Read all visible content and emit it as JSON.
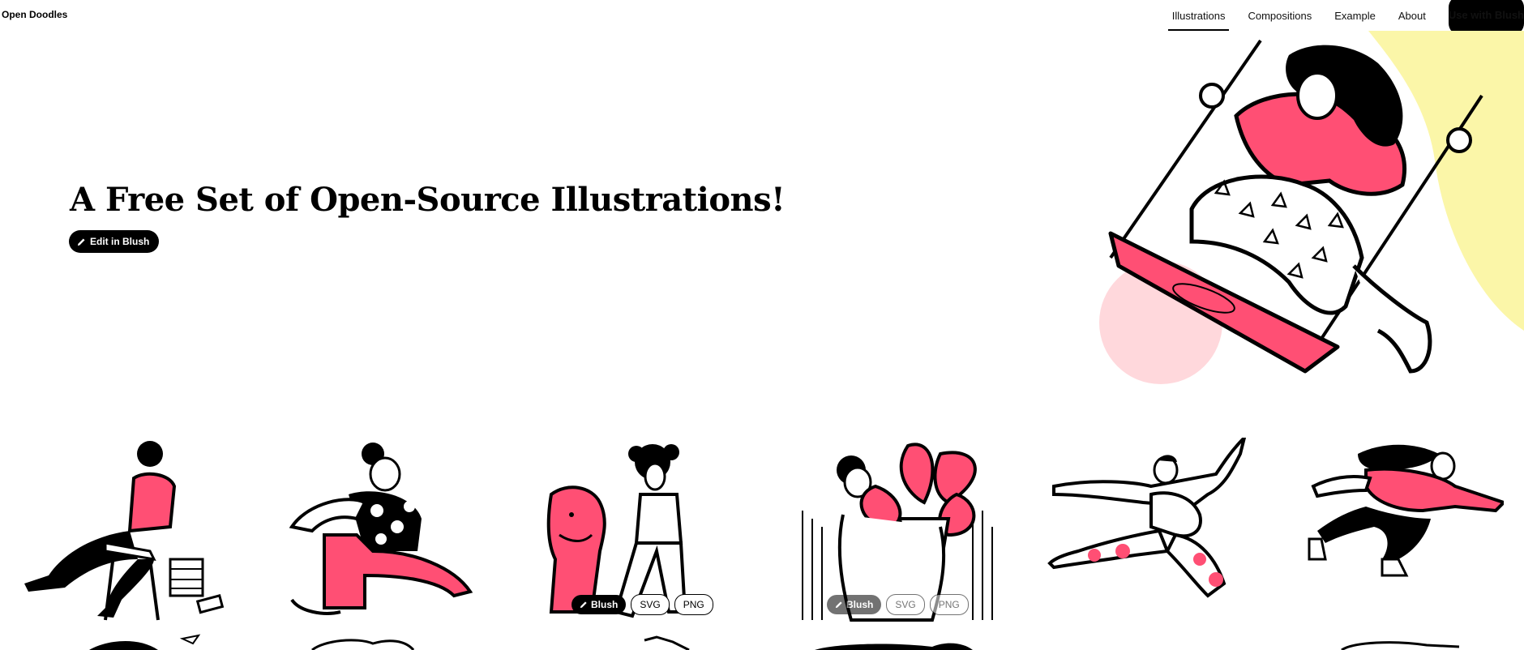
{
  "brand": {
    "name": "Open Doodles"
  },
  "nav": {
    "items": [
      {
        "label": "Illustrations",
        "active": true
      },
      {
        "label": "Compositions",
        "active": false
      },
      {
        "label": "Example",
        "active": false
      },
      {
        "label": "About",
        "active": false
      }
    ],
    "cta_label": "Use with Blush"
  },
  "hero": {
    "title": "A Free Set of Open-Source Illustrations!",
    "edit_button": {
      "label": "Edit in Blush",
      "icon": "pencil-icon"
    }
  },
  "colors": {
    "accent_pink": "#ff4f74",
    "soft_pink": "#ffd8dc",
    "soft_yellow": "#fbf6a8",
    "ink": "#000000"
  },
  "gallery": {
    "items": [
      {
        "name": "reading-side-doodle"
      },
      {
        "name": "sitting-doodle"
      },
      {
        "name": "dog-jump-doodle"
      },
      {
        "name": "plant-doodle"
      },
      {
        "name": "dancing-doodle"
      },
      {
        "name": "running-doodle"
      }
    ],
    "actions": {
      "blush_label": "Blush",
      "svg_label": "SVG",
      "png_label": "PNG"
    }
  }
}
